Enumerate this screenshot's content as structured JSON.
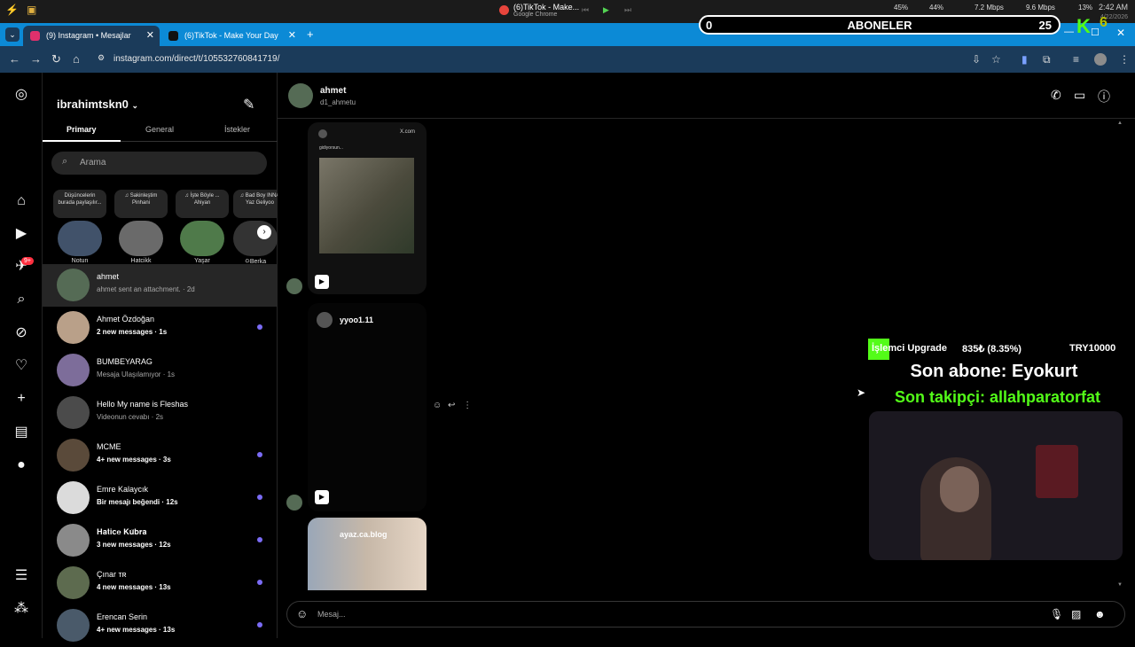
{
  "system_bar": {
    "media_title": "(6)TikTok - Make...",
    "media_subtitle": "Google Chrome",
    "cpu": "45%",
    "memory": "44%",
    "receive": "7.2 Mbps",
    "send": "9.6 Mbps",
    "battery": "13%",
    "time": "2:42 AM",
    "date": "4/22/2026"
  },
  "overlay": {
    "subs_left": "0",
    "subs_label": "ABONELER",
    "subs_right": "25",
    "goal_label": "İşlemci Upgrade",
    "goal_amount": "835₺ (8.35%)",
    "goal_target": "TRY10000",
    "last_sub": "Son abone: Eyokurt",
    "last_follow": "Son takipçi: allahparatorfat"
  },
  "browser": {
    "tabs": [
      {
        "label": "(9) Instagram • Mesajlar",
        "color": "#e1306c"
      },
      {
        "label": "(6)TikTok - Make Your Day",
        "color": "#111111"
      }
    ],
    "url": "instagram.com/direct/t/105532760841719/"
  },
  "inbox": {
    "username": "ibrahimtskn0",
    "tabs": [
      "Primary",
      "General",
      "İstekler"
    ],
    "search_placeholder": "Arama",
    "badge": "9+",
    "notes": [
      {
        "bubble": "Düşüncelerin burada paylaşılır...",
        "name": "Notun"
      },
      {
        "bubble": "♫ Sakinleştim Pinhani",
        "name": "Hatcikk"
      },
      {
        "bubble": "♫ İşte Böyle ... Ahiyan",
        "name": "Yaşar"
      },
      {
        "bubble": "♫ Bad Boy INNA Yaz Geliyoo",
        "name": "🌣Berka"
      }
    ],
    "threads": [
      {
        "name": "ahmet",
        "preview": "ahmet sent an attachment. · 2d",
        "active": true,
        "unread": false
      },
      {
        "name": "Ahmet Özdoğan",
        "preview": "2 new messages · 1s",
        "active": false,
        "unread": true
      },
      {
        "name": "BUMBEYARAG",
        "preview": "Mesaja Ulaşılamıyor · 1s",
        "active": false,
        "unread": false
      },
      {
        "name": "Hello My name is Fleshas",
        "preview": "Videonun cevabı · 2s",
        "active": false,
        "unread": false
      },
      {
        "name": "MCME",
        "preview": "4+ new messages · 3s",
        "active": false,
        "unread": true
      },
      {
        "name": "Emre Kalaycık",
        "preview": "Bir mesajı beğendi · 12s",
        "active": false,
        "unread": true
      },
      {
        "name": "𝐇𝐚𝐭𝐢𝐜𝐞 𝐊𝐮̈𝐛𝐫𝐚",
        "preview": "3 new messages · 12s",
        "active": false,
        "unread": true
      },
      {
        "name": "Çınar ᴛʀ",
        "preview": "4 new messages · 13s",
        "active": false,
        "unread": true
      },
      {
        "name": "Erencan Serin",
        "preview": "4+ new messages · 13s",
        "active": false,
        "unread": true
      }
    ]
  },
  "chat": {
    "name": "ahmet",
    "handle": "d1_ahmetu",
    "card1_header": "X.com",
    "card1_caption": "gidiyorsun...",
    "card2_user": "yyoo1.11",
    "card3_caption": "ayaz.ca.blog",
    "composer_placeholder": "Mesaj..."
  }
}
